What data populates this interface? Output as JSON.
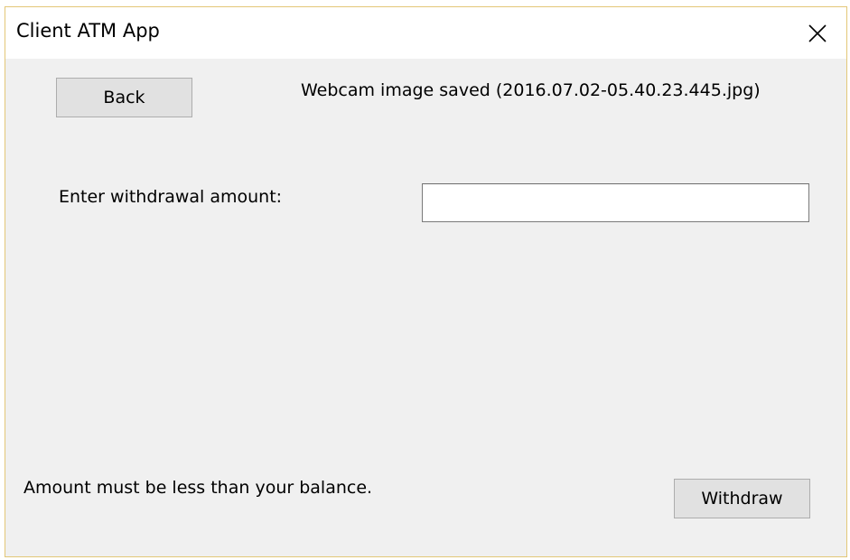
{
  "window": {
    "title": "Client ATM App"
  },
  "toolbar": {
    "back_label": "Back",
    "withdraw_label": "Withdraw"
  },
  "status": {
    "message": "Webcam image saved (2016.07.02-05.40.23.445.jpg)"
  },
  "form": {
    "amount_label": "Enter withdrawal amount:",
    "amount_value": "",
    "hint": "Amount must be less than your balance."
  },
  "icons": {
    "close": "close-icon"
  },
  "colors": {
    "window_bg": "#f0f0f0",
    "titlebar_bg": "#ffffff",
    "button_bg": "#e1e1e1",
    "window_border": "#e3c777"
  }
}
